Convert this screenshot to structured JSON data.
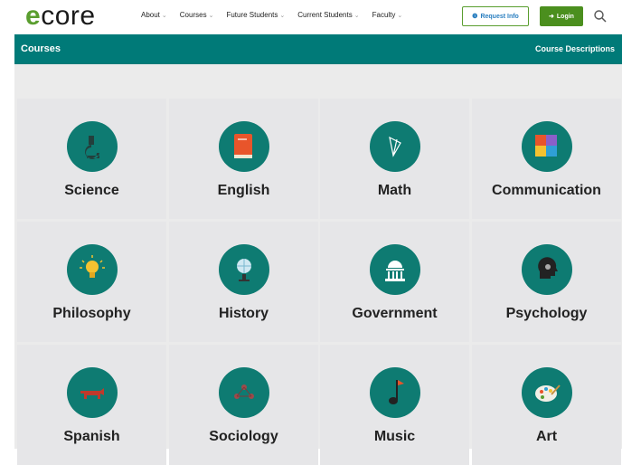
{
  "logo": {
    "e": "e",
    "rest": "core"
  },
  "nav": [
    {
      "label": "About",
      "chev": "⌄"
    },
    {
      "label": "Courses",
      "chev": "⌄"
    },
    {
      "label": "Future Students",
      "chev": "⌄"
    },
    {
      "label": "Current Students",
      "chev": "⌄"
    },
    {
      "label": "Faculty",
      "chev": "⌄"
    }
  ],
  "buttons": {
    "request_icon": "❶",
    "request": "Request Info",
    "login_icon": "➜",
    "login": "Login"
  },
  "bar": {
    "title": "Courses",
    "link": "Course Descriptions"
  },
  "courses": [
    {
      "label": "Science",
      "icon": "microscope-icon"
    },
    {
      "label": "English",
      "icon": "book-icon"
    },
    {
      "label": "Math",
      "icon": "geometry-icon"
    },
    {
      "label": "Communication",
      "icon": "puzzle-icon"
    },
    {
      "label": "Philosophy",
      "icon": "lightbulb-icon"
    },
    {
      "label": "History",
      "icon": "globe-icon"
    },
    {
      "label": "Government",
      "icon": "capitol-icon"
    },
    {
      "label": "Psychology",
      "icon": "head-gear-icon"
    },
    {
      "label": "Spanish",
      "icon": "bull-icon"
    },
    {
      "label": "Sociology",
      "icon": "network-icon"
    },
    {
      "label": "Music",
      "icon": "music-note-icon"
    },
    {
      "label": "Art",
      "icon": "palette-icon"
    }
  ],
  "colors": {
    "teal": "#007a78",
    "circle": "#0e7b72",
    "green": "#4b8f1e",
    "logo_green": "#5a9e2f"
  }
}
